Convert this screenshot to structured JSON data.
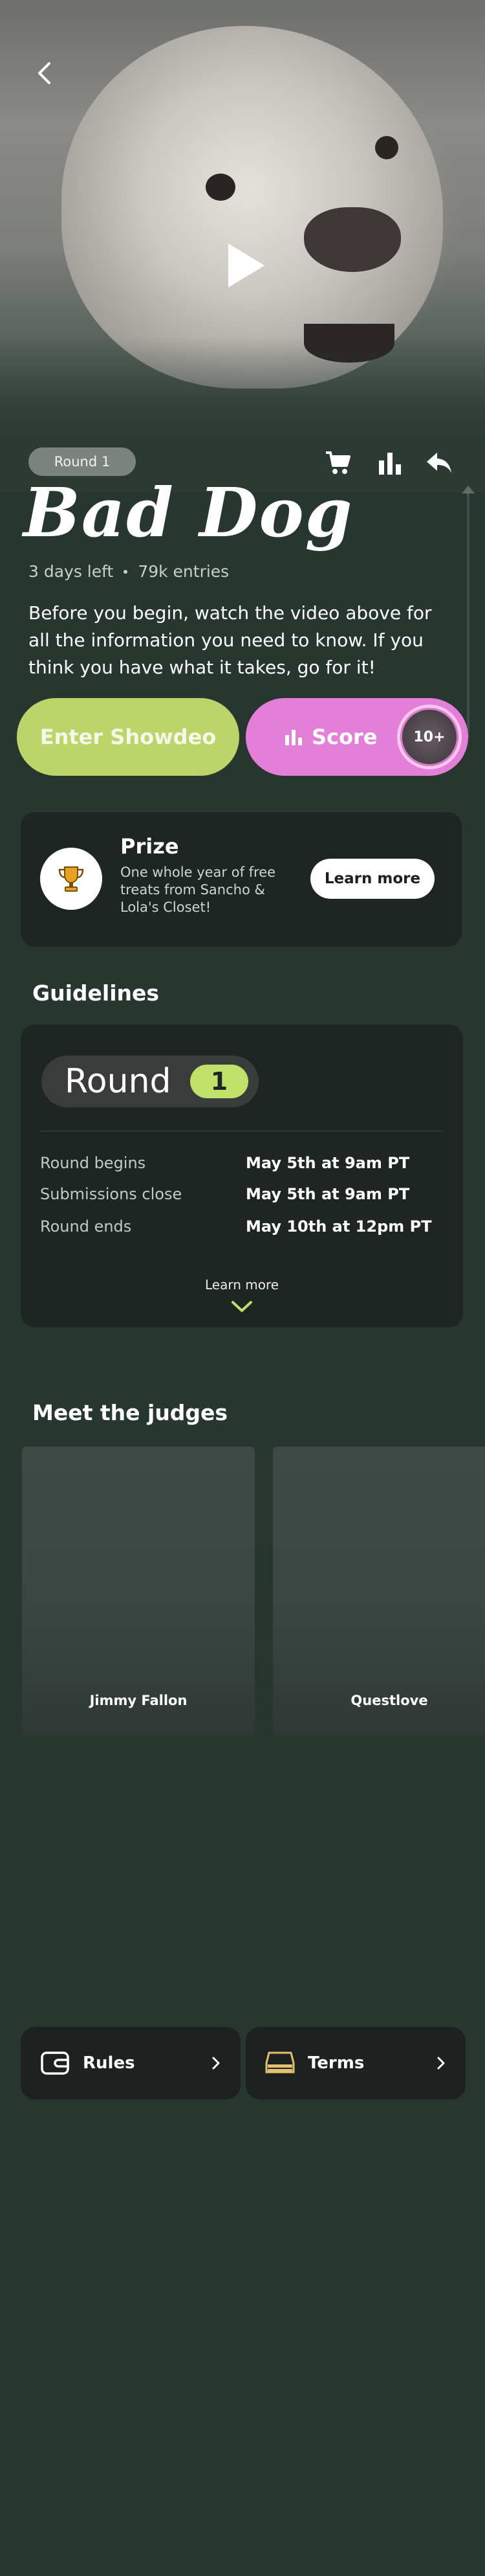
{
  "hero": {
    "round_badge": "Round 1",
    "title": "Bad Dog",
    "time_left": "3 days left",
    "entries": "79k entries",
    "description": "Before you begin, watch the video above for all the information you need to know. If you think you have what it takes, go for it!"
  },
  "actions": {
    "enter_label": "Enter Showdeo",
    "score_label": "Score",
    "score_count": "10+"
  },
  "prize": {
    "title": "Prize",
    "description": "One whole year of free treats from Sancho & Lola's Closet!",
    "learn_more": "Learn more"
  },
  "guidelines": {
    "heading": "Guidelines",
    "round_word": "Round",
    "round_number": "1",
    "rows": [
      {
        "label": "Round begins",
        "value": "May 5th at 9am PT"
      },
      {
        "label": "Submissions close",
        "value": "May 5th at 9am PT"
      },
      {
        "label": "Round ends",
        "value": "May 10th at 12pm PT"
      }
    ],
    "learn_more": "Learn more"
  },
  "judges": {
    "heading": "Meet the judges",
    "items": [
      {
        "name": "Jimmy Fallon"
      },
      {
        "name": "Questlove"
      }
    ]
  },
  "footer": {
    "rules_label": "Rules",
    "terms_label": "Terms"
  },
  "colors": {
    "background": "#283630",
    "enter_button": "#bcd46a",
    "score_button": "#e47fd9",
    "round_number_chip": "#bfe16a",
    "card": "#1f2522"
  },
  "icons": [
    "back-icon",
    "play-icon",
    "cart-icon",
    "bar-chart-icon",
    "share-icon",
    "trophy-icon",
    "chevron-down-icon",
    "wallet-icon",
    "terms-icon",
    "chevron-right-icon"
  ]
}
